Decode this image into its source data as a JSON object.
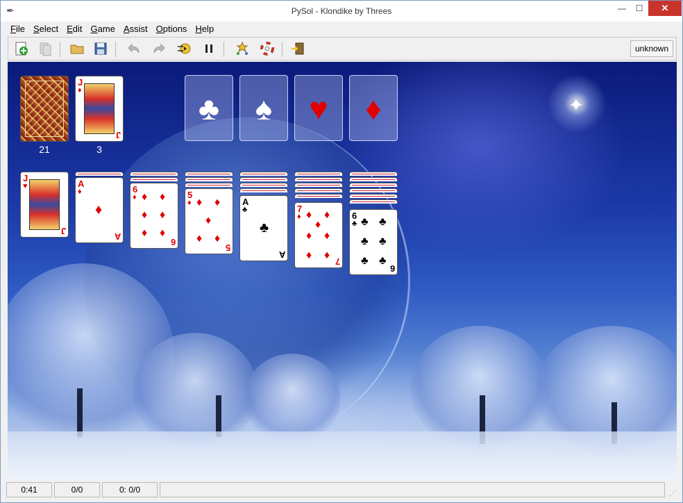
{
  "window": {
    "title": "PySol - Klondike by Threes"
  },
  "menu": {
    "items": [
      {
        "label": "File",
        "key": "F",
        "rest": "ile"
      },
      {
        "label": "Select",
        "key": "S",
        "rest": "elect"
      },
      {
        "label": "Edit",
        "key": "E",
        "rest": "dit"
      },
      {
        "label": "Game",
        "key": "G",
        "rest": "ame"
      },
      {
        "label": "Assist",
        "key": "A",
        "rest": "ssist"
      },
      {
        "label": "Options",
        "key": "O",
        "rest": "ptions"
      },
      {
        "label": "Help",
        "key": "H",
        "rest": "elp"
      }
    ]
  },
  "toolbar": {
    "status": "unknown",
    "buttons": [
      "new-game-icon",
      "restart-icon",
      "open-icon",
      "save-icon",
      "undo-icon",
      "redo-icon",
      "autodrop-icon",
      "pause-icon",
      "stats-icon",
      "help-icon",
      "quit-icon"
    ]
  },
  "table": {
    "stock_count": "21",
    "waste_count": "3",
    "waste_top": {
      "rank": "J",
      "suit": "♦",
      "color": "red"
    },
    "foundations": [
      {
        "suit": "♣",
        "color": "#ffffff"
      },
      {
        "suit": "♠",
        "color": "#ffffff"
      },
      {
        "suit": "♥",
        "color": "#e00000"
      },
      {
        "suit": "♦",
        "color": "#e00000"
      }
    ],
    "tableau": [
      {
        "rank": "J",
        "suit": "♥",
        "color": "red"
      },
      {
        "rank": "A",
        "suit": "♦",
        "color": "red"
      },
      {
        "rank": "6",
        "suit": "♦",
        "color": "red"
      },
      {
        "rank": "5",
        "suit": "♦",
        "color": "red"
      },
      {
        "rank": "A",
        "suit": "♣",
        "color": "black"
      },
      {
        "rank": "7",
        "suit": "♦",
        "color": "red"
      },
      {
        "rank": "6",
        "suit": "♣",
        "color": "black"
      }
    ]
  },
  "status": {
    "time": "0:41",
    "moves": "0/0",
    "score": "0: 0/0",
    "message": ""
  }
}
